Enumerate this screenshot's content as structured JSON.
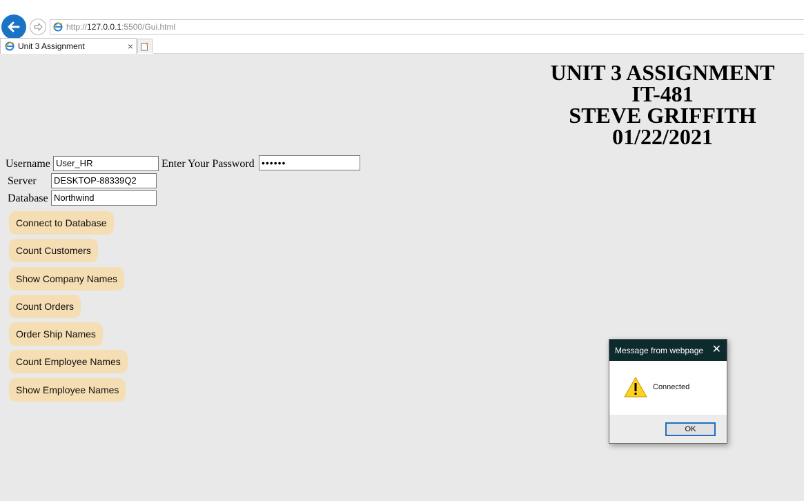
{
  "browser": {
    "url_prefix": "http://",
    "url_host": "127.0.0.1",
    "url_suffix": ":5500/Gui.html",
    "tab_title": "Unit 3 Assignment",
    "tab_close_glyph": "×"
  },
  "page": {
    "heading_lines": [
      "UNIT 3 ASSIGNMENT",
      "IT-481",
      "STEVE GRIFFITH",
      "01/22/2021"
    ],
    "form": {
      "username_label": "Username",
      "username_value": "User_HR",
      "password_label": "Enter Your Password",
      "password_value": "••••••",
      "server_label": "Server",
      "server_value": "DESKTOP-88339Q2",
      "database_label": "Database",
      "database_value": "Northwind"
    },
    "buttons": [
      "Connect to Database",
      "Count Customers",
      "Show Company Names",
      "Count Orders",
      "Order Ship Names",
      "Count Employee Names",
      "Show Employee Names"
    ],
    "button_color": "#f5deb3"
  },
  "dialog": {
    "title": "Message from webpage",
    "message": "Connected",
    "ok_label": "OK",
    "close_glyph": "✕"
  }
}
